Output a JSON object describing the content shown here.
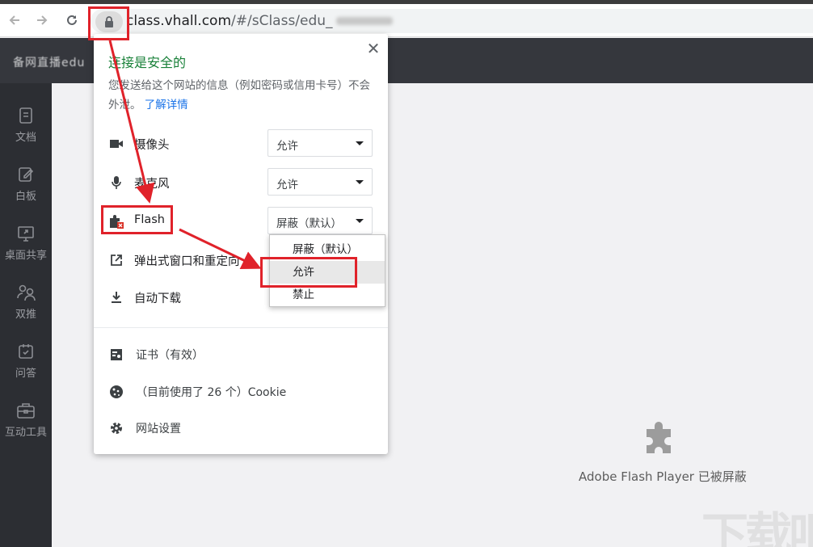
{
  "browser": {
    "url_host": "class.vhall.com",
    "url_path": "/#/sClass/edu_"
  },
  "site": {
    "header_title": "备网直播edu"
  },
  "sidebar": {
    "items": [
      {
        "label": "文档",
        "icon": "document-icon"
      },
      {
        "label": "白板",
        "icon": "whiteboard-icon"
      },
      {
        "label": "桌面共享",
        "icon": "screen-share-icon"
      },
      {
        "label": "双推",
        "icon": "dual-push-icon"
      },
      {
        "label": "问答",
        "icon": "qa-icon"
      },
      {
        "label": "互动工具",
        "icon": "toolbox-icon"
      }
    ]
  },
  "main": {
    "flash_blocked_text": "Adobe Flash Player 已被屏蔽",
    "watermark": "下载吧"
  },
  "popup": {
    "title": "连接是安全的",
    "description": "您发送给这个网站的信息（例如密码或信用卡号）不会外泄。",
    "learn_more": "了解详情",
    "permissions": [
      {
        "label": "摄像头",
        "value": "允许",
        "icon": "camera-icon"
      },
      {
        "label": "麦克风",
        "value": "允许",
        "icon": "microphone-icon"
      },
      {
        "label": "Flash",
        "value": "屏蔽（默认）",
        "icon": "plugin-icon"
      },
      {
        "label": "弹出式窗口和重定向",
        "value": "",
        "icon": "popup-icon"
      },
      {
        "label": "自动下载",
        "value": "",
        "icon": "download-icon"
      }
    ],
    "info": [
      {
        "label": "证书（有效）",
        "icon": "certificate-icon"
      },
      {
        "label": "（目前使用了 26 个）Cookie",
        "icon": "cookie-icon"
      },
      {
        "label": "网站设置",
        "icon": "settings-gear-icon"
      }
    ],
    "flash_dropdown": {
      "options": [
        "屏蔽（默认）",
        "允许",
        "禁止"
      ],
      "highlighted": "允许"
    }
  },
  "colors": {
    "secure_green": "#188038",
    "link_blue": "#1a73e8",
    "annotation_red": "#e0222a",
    "sidebar_bg": "#2c2e33",
    "header_bg": "#35373d"
  }
}
